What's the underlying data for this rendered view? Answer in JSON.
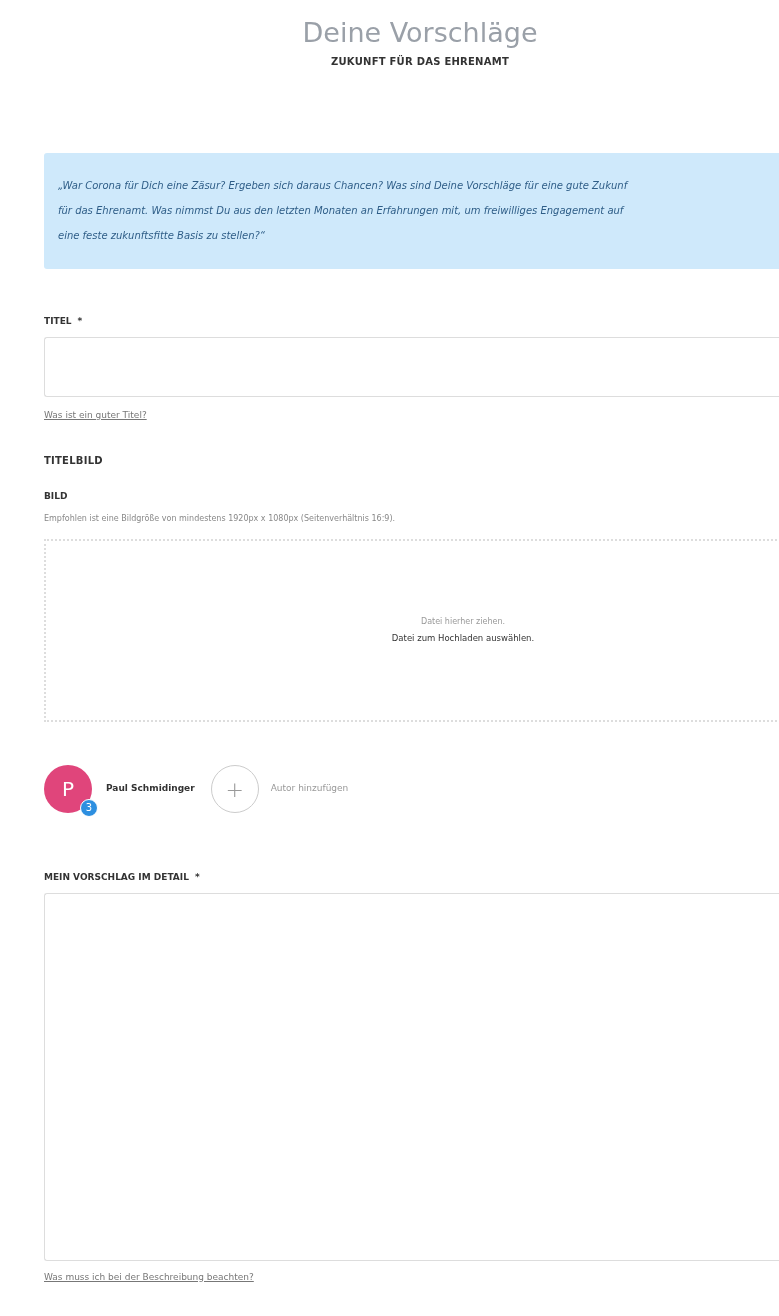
{
  "header": {
    "title": "Deine Vorschläge",
    "subtitle": "ZUKUNFT FÜR DAS EHRENAMT"
  },
  "quote": {
    "lines": [
      "„War Corona für Dich eine Zäsur? Ergeben sich daraus Chancen? Was sind Deine Vorschläge für eine gute Zukunf",
      "für das Ehrenamt. Was nimmst Du aus den letzten Monaten an Erfahrungen mit, um freiwilliges Engagement auf",
      "eine feste zukunftsfitte Basis zu stellen?“"
    ]
  },
  "title_field": {
    "label": "TITEL",
    "required_mark": "*",
    "help_link": "Was ist ein guter Titel?"
  },
  "image_section": {
    "heading": "TITELBILD",
    "label": "BILD",
    "hint": "Empfohlen ist eine Bildgröße von mindestens 1920px x 1080px (Seitenverhältnis 16:9).",
    "dropzone": {
      "drag_text": "Datei hierher ziehen.",
      "select_text": "Datei zum Hochladen auswählen."
    }
  },
  "authors": {
    "items": [
      {
        "initial": "P",
        "name": "Paul Schmidinger",
        "badge": "3",
        "color": "#e0457b"
      }
    ],
    "add_label": "Autor hinzufügen",
    "add_icon": "+"
  },
  "detail_field": {
    "label": "MEIN VORSCHLAG IM DETAIL",
    "required_mark": "*",
    "help_link": "Was muss ich bei der Beschreibung beachten?"
  }
}
